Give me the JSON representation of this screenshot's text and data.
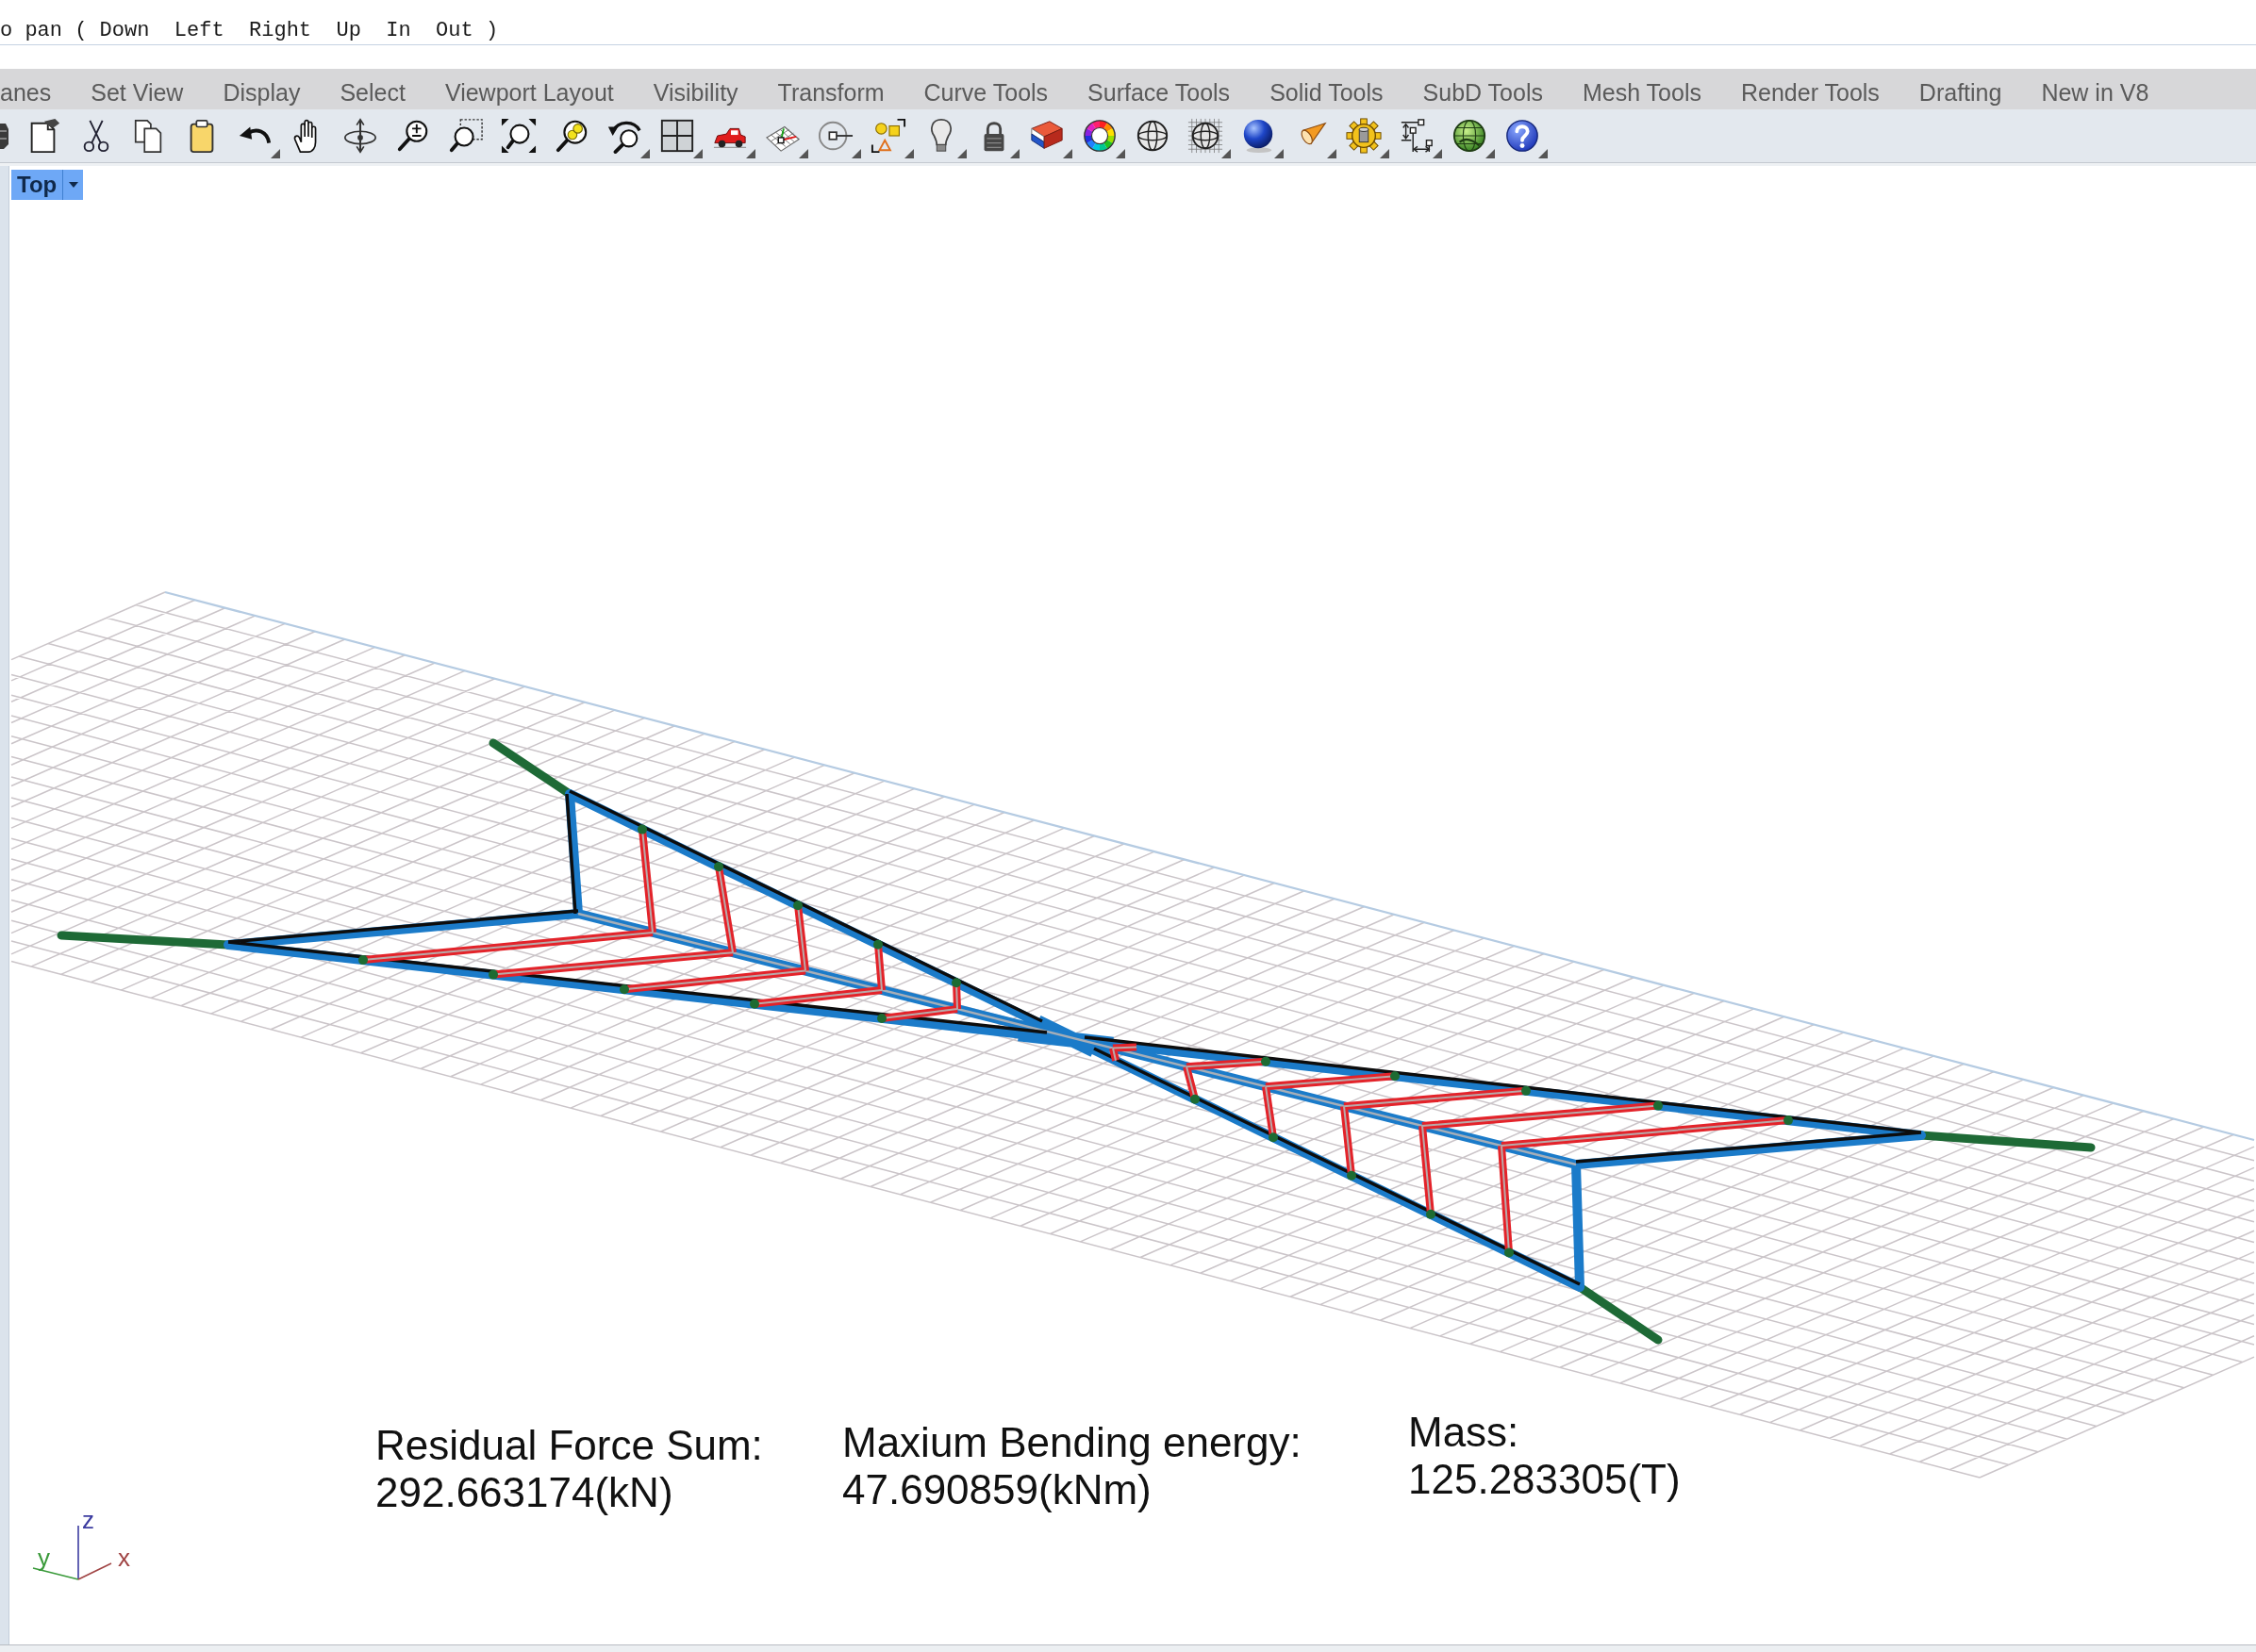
{
  "command_line": {
    "text": "o pan ( Down  Left  Right  Up  In  Out )"
  },
  "menu_tabs": [
    {
      "label": "anes"
    },
    {
      "label": "Set View"
    },
    {
      "label": "Display"
    },
    {
      "label": "Select"
    },
    {
      "label": "Viewport Layout"
    },
    {
      "label": "Visibility"
    },
    {
      "label": "Transform"
    },
    {
      "label": "Curve Tools"
    },
    {
      "label": "Surface Tools"
    },
    {
      "label": "Solid Tools"
    },
    {
      "label": "SubD Tools"
    },
    {
      "label": "Mesh Tools"
    },
    {
      "label": "Render Tools"
    },
    {
      "label": "Drafting"
    },
    {
      "label": "New in V8"
    }
  ],
  "toolbar": [
    {
      "flyout": false
    },
    {
      "flyout": false
    },
    {
      "flyout": false
    },
    {
      "flyout": false
    },
    {
      "flyout": false
    },
    {
      "flyout": true
    },
    {
      "flyout": false
    },
    {
      "flyout": false
    },
    {
      "flyout": false
    },
    {
      "flyout": false
    },
    {
      "flyout": false
    },
    {
      "flyout": false
    },
    {
      "flyout": true
    },
    {
      "flyout": true
    },
    {
      "flyout": true
    },
    {
      "flyout": true
    },
    {
      "flyout": true
    },
    {
      "flyout": true
    },
    {
      "flyout": true
    },
    {
      "flyout": true
    },
    {
      "flyout": true
    },
    {
      "flyout": true
    },
    {
      "flyout": false
    },
    {
      "flyout": true
    },
    {
      "flyout": true
    },
    {
      "flyout": true
    },
    {
      "flyout": true
    },
    {
      "flyout": true
    },
    {
      "flyout": true
    },
    {
      "flyout": true
    }
  ],
  "viewport": {
    "title": "Top",
    "readouts": [
      {
        "label": "Residual Force Sum:",
        "value": "292.663174(kN)"
      },
      {
        "label": "Maxium Bending energy:",
        "value": "47.690859(kNm)"
      },
      {
        "label": "Mass:",
        "value": "125.283305(T)"
      }
    ],
    "axes": [
      {
        "label": "z",
        "color": "#3c3ca0"
      },
      {
        "label": "y",
        "color": "#3a9a3a"
      },
      {
        "label": "x",
        "color": "#a04444"
      }
    ]
  }
}
